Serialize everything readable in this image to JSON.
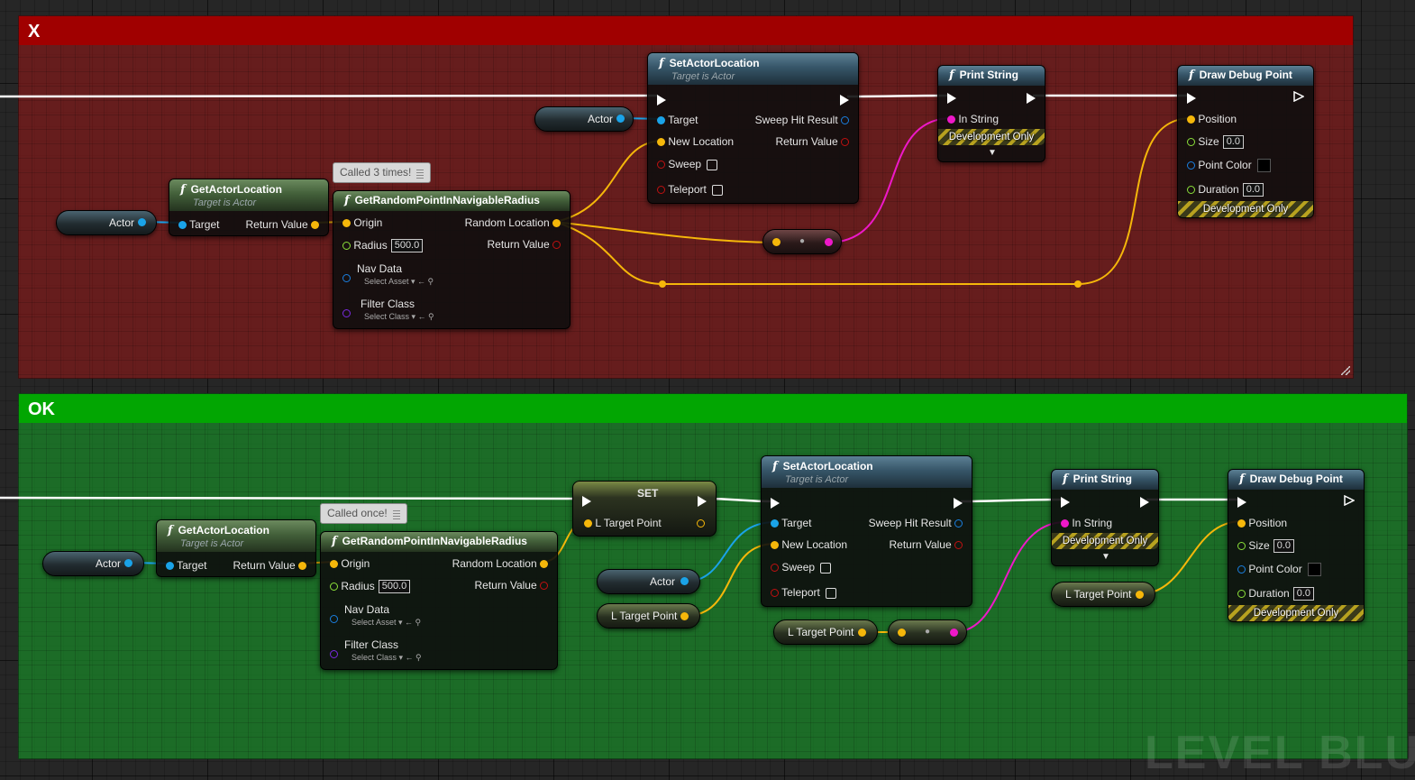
{
  "comments": {
    "bad": "X",
    "good": "OK"
  },
  "bad": {
    "bubble": "Called 3 times!",
    "actor_var1": "Actor",
    "actor_var2": "Actor",
    "get_loc": {
      "title": "GetActorLocation",
      "sub": "Target is Actor",
      "target": "Target",
      "ret": "Return Value"
    },
    "rand": {
      "title": "GetRandomPointInNavigableRadius",
      "origin": "Origin",
      "random": "Random Location",
      "radius": "Radius",
      "radius_val": "500.0",
      "ret": "Return Value",
      "nav": "Nav Data",
      "nav_sel": "Select Asset",
      "filter": "Filter Class",
      "filter_sel": "Select Class"
    },
    "set_loc": {
      "title": "SetActorLocation",
      "sub": "Target is Actor",
      "target": "Target",
      "sweep_hit": "Sweep Hit Result",
      "new_loc": "New Location",
      "ret": "Return Value",
      "sweep": "Sweep",
      "teleport": "Teleport"
    },
    "print": {
      "title": "Print String",
      "in": "In String",
      "dev": "Development Only"
    },
    "debug": {
      "title": "Draw Debug Point",
      "pos": "Position",
      "size": "Size",
      "size_val": "0.0",
      "color": "Point Color",
      "dur": "Duration",
      "dur_val": "0.0",
      "dev": "Development Only"
    }
  },
  "good": {
    "bubble": "Called once!",
    "actor_var1": "Actor",
    "actor_var2": "Actor",
    "ltp1": "L Target Point",
    "ltp2": "L Target Point",
    "ltp3": "L Target Point",
    "get_loc": {
      "title": "GetActorLocation",
      "sub": "Target is Actor",
      "target": "Target",
      "ret": "Return Value"
    },
    "rand": {
      "title": "GetRandomPointInNavigableRadius",
      "origin": "Origin",
      "random": "Random Location",
      "radius": "Radius",
      "radius_val": "500.0",
      "ret": "Return Value",
      "nav": "Nav Data",
      "nav_sel": "Select Asset",
      "filter": "Filter Class",
      "filter_sel": "Select Class"
    },
    "set": {
      "title": "SET",
      "ltp": "L Target Point"
    },
    "set_loc": {
      "title": "SetActorLocation",
      "sub": "Target is Actor",
      "target": "Target",
      "sweep_hit": "Sweep Hit Result",
      "new_loc": "New Location",
      "ret": "Return Value",
      "sweep": "Sweep",
      "teleport": "Teleport"
    },
    "print": {
      "title": "Print String",
      "in": "In String",
      "dev": "Development Only"
    },
    "debug": {
      "title": "Draw Debug Point",
      "pos": "Position",
      "size": "Size",
      "size_val": "0.0",
      "color": "Point Color",
      "dur": "Duration",
      "dur_val": "0.0",
      "dev": "Development Only"
    }
  },
  "watermark": "LEVEL BLUE",
  "colors": {
    "bad_header": "#a00000",
    "good_header": "#02a602",
    "exec_wire": "#ffffff",
    "vector_wire": "#f5b70a",
    "string_wire": "#ee18c8",
    "object_wire": "#1aa3e8"
  }
}
